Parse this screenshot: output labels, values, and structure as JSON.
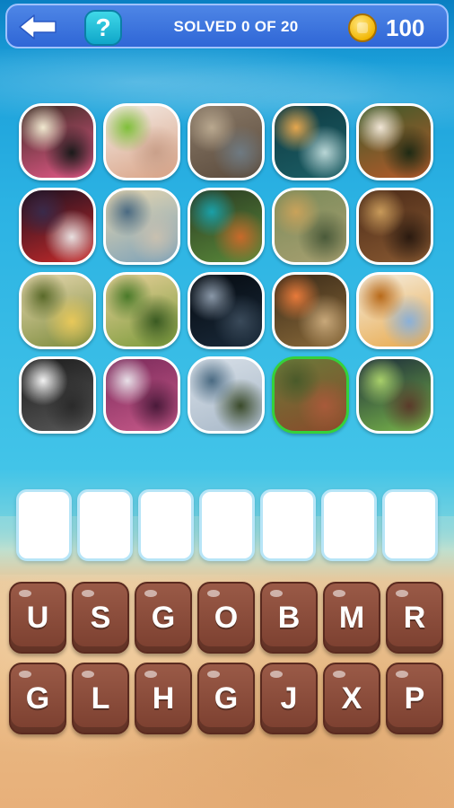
{
  "header": {
    "solved_text": "SOLVED 0 OF 20",
    "coins": "100",
    "help_label": "?"
  },
  "tiles": [
    {
      "id": "licorice-candy",
      "palette": [
        "#3a2a22",
        "#e85a8a",
        "#f1e9d0",
        "#1a1a1a"
      ]
    },
    {
      "id": "woman-eating-lime",
      "palette": [
        "#f3ece6",
        "#d9a285",
        "#7fbf3a",
        "#c9a08a"
      ]
    },
    {
      "id": "seal-on-bench",
      "palette": [
        "#8a7a68",
        "#5a4a3c",
        "#b9a88f",
        "#6e7a82"
      ]
    },
    {
      "id": "jellyfish",
      "palette": [
        "#0e3a42",
        "#1c5f66",
        "#e6a74e",
        "#b9d6d6"
      ]
    },
    {
      "id": "red-panda",
      "palette": [
        "#3d5a2a",
        "#b85a2a",
        "#f1e6d6",
        "#1e2a14"
      ]
    },
    {
      "id": "ceremony-flag",
      "palette": [
        "#1a1020",
        "#c82a2a",
        "#3a2a4a",
        "#e8e0e0"
      ]
    },
    {
      "id": "harbor-city",
      "palette": [
        "#e8d7b0",
        "#7aa0b8",
        "#4a6a82",
        "#c8c0b0"
      ]
    },
    {
      "id": "motmot-bird",
      "palette": [
        "#2a3a22",
        "#5a8a3a",
        "#1aa0a8",
        "#c86a2a"
      ]
    },
    {
      "id": "heron-bird",
      "palette": [
        "#7a8a5a",
        "#a8a070",
        "#c9a25a",
        "#4a5a3a"
      ]
    },
    {
      "id": "walnuts",
      "palette": [
        "#4a2a18",
        "#8a5a32",
        "#c89a5a",
        "#2a1a10"
      ]
    },
    {
      "id": "artichokes",
      "palette": [
        "#e8d8b0",
        "#7a8a3a",
        "#5a6a2a",
        "#e8c85a"
      ]
    },
    {
      "id": "green-hills",
      "palette": [
        "#e8d09a",
        "#7a9a3a",
        "#4a7a2a",
        "#3a5a22"
      ]
    },
    {
      "id": "shark",
      "palette": [
        "#050a10",
        "#1a2a3a",
        "#8a98a8",
        "#3a4a5a"
      ]
    },
    {
      "id": "bird-nest-chicks",
      "palette": [
        "#3a2a18",
        "#8a6a3a",
        "#e87a3a",
        "#c8a87a"
      ]
    },
    {
      "id": "pancakes-syrup",
      "palette": [
        "#f5efe2",
        "#e8a84a",
        "#b86a1a",
        "#8ab0d8"
      ]
    },
    {
      "id": "arctic-fox",
      "palette": [
        "#1a1a1a",
        "#5a5a5a",
        "#f2f2f2",
        "#2a2a2a"
      ]
    },
    {
      "id": "red-cabbage",
      "palette": [
        "#7a2a5a",
        "#c85a8a",
        "#e8e0e8",
        "#4a1a3a"
      ]
    },
    {
      "id": "geyser",
      "palette": [
        "#d8e0e8",
        "#a8b8c8",
        "#4a6a82",
        "#3a4a2a"
      ]
    },
    {
      "id": "sorghum",
      "palette": [
        "#6a7a3a",
        "#8a4a2a",
        "#4a5a2a",
        "#a85a3a"
      ]
    },
    {
      "id": "matcha-ice-cream",
      "palette": [
        "#1a2a3a",
        "#7ab84a",
        "#a8d06a",
        "#5a3a2a"
      ]
    }
  ],
  "answer_slots": 7,
  "letters_row1": [
    "U",
    "S",
    "G",
    "O",
    "B",
    "M",
    "R"
  ],
  "letters_row2": [
    "G",
    "L",
    "H",
    "G",
    "J",
    "X",
    "P"
  ],
  "selected_tile": "sorghum"
}
